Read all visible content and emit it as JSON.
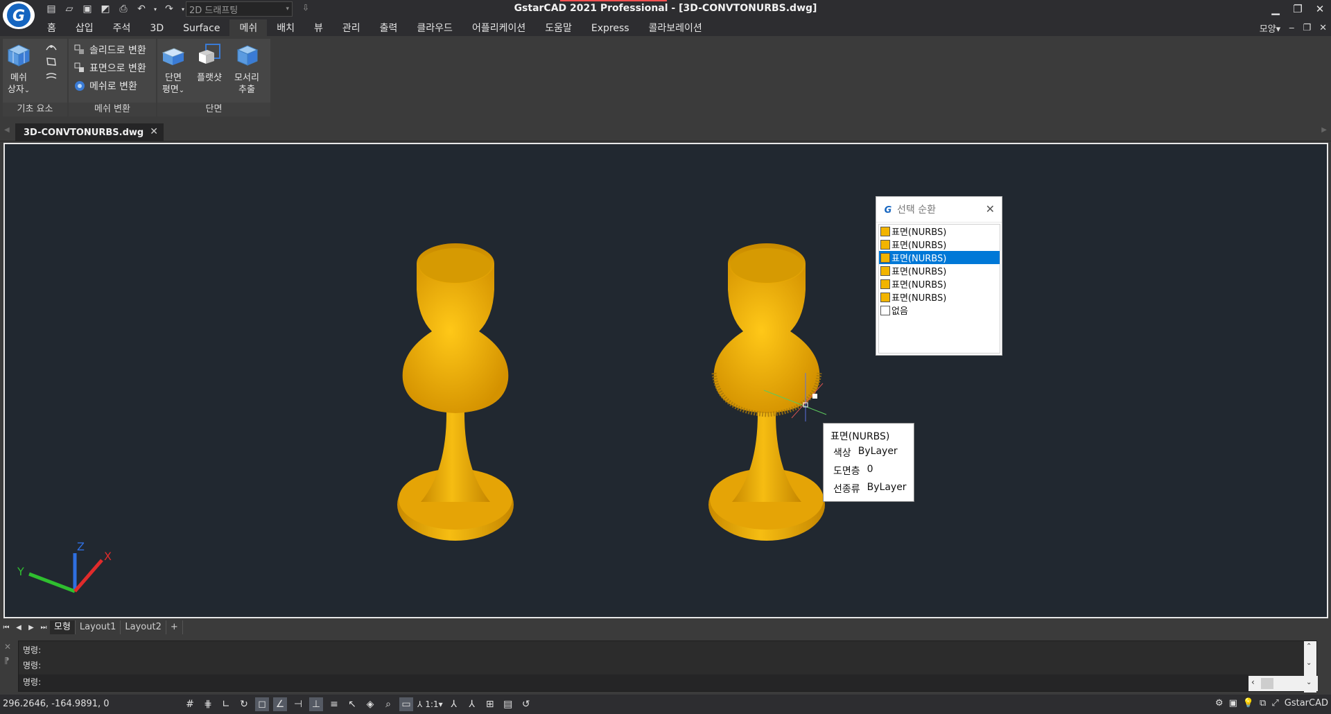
{
  "app": {
    "title": "GstarCAD 2021 Professional - [3D-CONVTONURBS.dwg]",
    "workspace": "2D 드래프팅"
  },
  "menu": {
    "tabs": [
      "홈",
      "삽입",
      "주석",
      "3D",
      "Surface",
      "메쉬",
      "배치",
      "뷰",
      "관리",
      "출력",
      "클라우드",
      "어플리케이션",
      "도움말",
      "Express",
      "콜라보레이션"
    ],
    "active_tab": "메쉬",
    "appearance": "모양"
  },
  "ribbon": {
    "panels": {
      "basic": {
        "title": "기초 요소",
        "mesh_box_line1": "메쉬",
        "mesh_box_line2": "상자"
      },
      "convert": {
        "title": "메쉬 변환",
        "to_solid": "솔리드로 변환",
        "to_surface": "표면으로 변환",
        "to_mesh": "메쉬로 변환"
      },
      "section": {
        "title": "단면",
        "section_plane_line1": "단면",
        "section_plane_line2": "평면",
        "flatshot": "플랫샷",
        "extract_edges_line1": "모서리",
        "extract_edges_line2": "추출"
      }
    }
  },
  "document": {
    "tab_name": "3D-CONVTONURBS.dwg"
  },
  "selection_cycling": {
    "title": "선택 순환",
    "items": [
      {
        "label": "표면(NURBS)",
        "color": "#f2b400",
        "selected": false
      },
      {
        "label": "표면(NURBS)",
        "color": "#f2b400",
        "selected": false
      },
      {
        "label": "표면(NURBS)",
        "color": "#f2b400",
        "selected": true
      },
      {
        "label": "표면(NURBS)",
        "color": "#f2b400",
        "selected": false
      },
      {
        "label": "표면(NURBS)",
        "color": "#f2b400",
        "selected": false
      },
      {
        "label": "표면(NURBS)",
        "color": "#f2b400",
        "selected": false
      },
      {
        "label": "없음",
        "color": "#ffffff",
        "selected": false
      }
    ]
  },
  "tooltip": {
    "title": "표면(NURBS)",
    "rows": [
      {
        "key": "색상",
        "value": "ByLayer"
      },
      {
        "key": "도면층",
        "value": "0"
      },
      {
        "key": "선종류",
        "value": "ByLayer"
      }
    ]
  },
  "ucs": {
    "x_label": "X",
    "y_label": "Y",
    "z_label": "Z"
  },
  "layout_tabs": [
    "모형",
    "Layout1",
    "Layout2",
    "+"
  ],
  "command": {
    "lines": [
      "명령:",
      "명령:",
      "명령:"
    ]
  },
  "status": {
    "coords": "296.2646, -164.9891, 0",
    "scale": "1:1",
    "brand": "GstarCAD"
  },
  "colors": {
    "accent": "#0078d7",
    "model_gold": "#f2b400",
    "viewport_bg": "#212830"
  }
}
